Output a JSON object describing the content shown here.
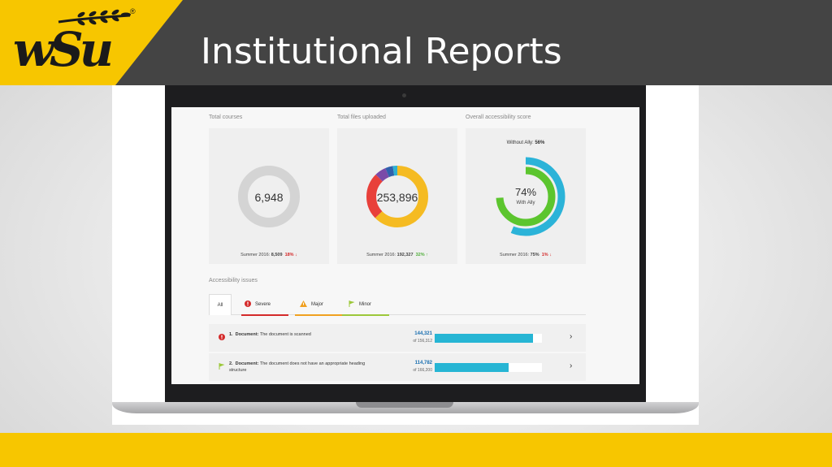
{
  "slide": {
    "title": "Institutional Reports",
    "logo_text": "wSu",
    "logo_registered": "®",
    "colors": {
      "header": "#444444",
      "accent": "#f7c600"
    }
  },
  "dashboard": {
    "cards": [
      {
        "label": "Total courses",
        "value": "6,948",
        "footer_prefix": "Summer 2016:",
        "footer_value": "8,509",
        "delta": "18%",
        "delta_direction": "down",
        "delta_arrow": "↓"
      },
      {
        "label": "Total files uploaded",
        "value": "253,896",
        "footer_prefix": "Summer 2016:",
        "footer_value": "192,327",
        "delta": "32%",
        "delta_direction": "up",
        "delta_arrow": "↑"
      },
      {
        "label": "Overall accessibility score",
        "top_text_prefix": "Without Ally:",
        "top_text_value": "56%",
        "value": "74%",
        "sub": "With Ally",
        "footer_prefix": "Summer 2016:",
        "footer_value": "75%",
        "delta": "1%",
        "delta_direction": "down",
        "delta_arrow": "↓"
      }
    ],
    "issues_label": "Accessibility issues",
    "tabs": [
      {
        "label": "All",
        "icon": "none"
      },
      {
        "label": "Severe",
        "icon": "severe-icon",
        "color": "#d42a2a"
      },
      {
        "label": "Major",
        "icon": "major-warning-icon",
        "color": "#f0a020"
      },
      {
        "label": "Minor",
        "icon": "minor-flag-icon",
        "color": "#9cc83a"
      }
    ],
    "issues": [
      {
        "number": "1.",
        "type": "Document:",
        "description": "The document is scanned",
        "count": "144,321",
        "total": "of 156,312",
        "fraction": 0.92,
        "severity": "severe"
      },
      {
        "number": "2.",
        "type": "Document:",
        "description": "The document does not have an appropriate heading structure",
        "count": "114,782",
        "total": "of 166,200",
        "fraction": 0.69,
        "severity": "minor"
      }
    ],
    "chevron": "›"
  }
}
